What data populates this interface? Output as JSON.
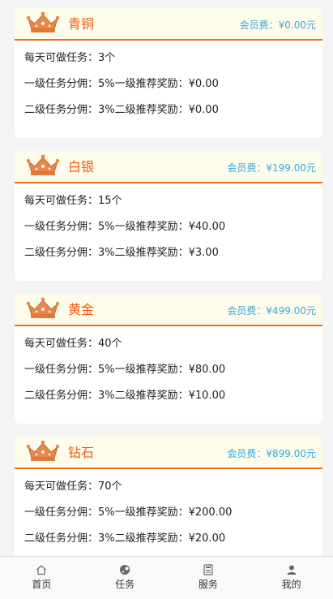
{
  "levels": [
    {
      "name": "青铜",
      "fee": "会员费：¥0.00元",
      "daily": "每天可做任务：3个",
      "level1": "一级任务分佣：5%一级推荐奖励：¥0.00",
      "level2": "二级任务分佣：3%二级推荐奖励：¥0.00"
    },
    {
      "name": "白银",
      "fee": "会员费：¥199.00元",
      "daily": "每天可做任务：15个",
      "level1": "一级任务分佣：5%一级推荐奖励：¥40.00",
      "level2": "二级任务分佣：3%二级推荐奖励：¥3.00"
    },
    {
      "name": "黄金",
      "fee": "会员费：¥499.00元",
      "daily": "每天可做任务：40个",
      "level1": "一级任务分佣：5%一级推荐奖励：¥80.00",
      "level2": "二级任务分佣：3%二级推荐奖励：¥10.00"
    },
    {
      "name": "钻石",
      "fee": "会员费：¥899.00元",
      "daily": "每天可做任务：70个",
      "level1": "一级任务分佣：5%一级推荐奖励：¥200.00",
      "level2": "二级任务分佣：3%二级推荐奖励：¥20.00"
    }
  ],
  "tabs": [
    {
      "label": "首页",
      "icon": "home-icon"
    },
    {
      "label": "任务",
      "icon": "task-icon"
    },
    {
      "label": "服务",
      "icon": "service-icon"
    },
    {
      "label": "我的",
      "icon": "user-icon"
    }
  ],
  "colors": {
    "accent": "#f26a1b",
    "level_name": "#ee5d16",
    "fee": "#39a9df",
    "header_bg": "#fdfbea",
    "crown": "#e8884a"
  }
}
